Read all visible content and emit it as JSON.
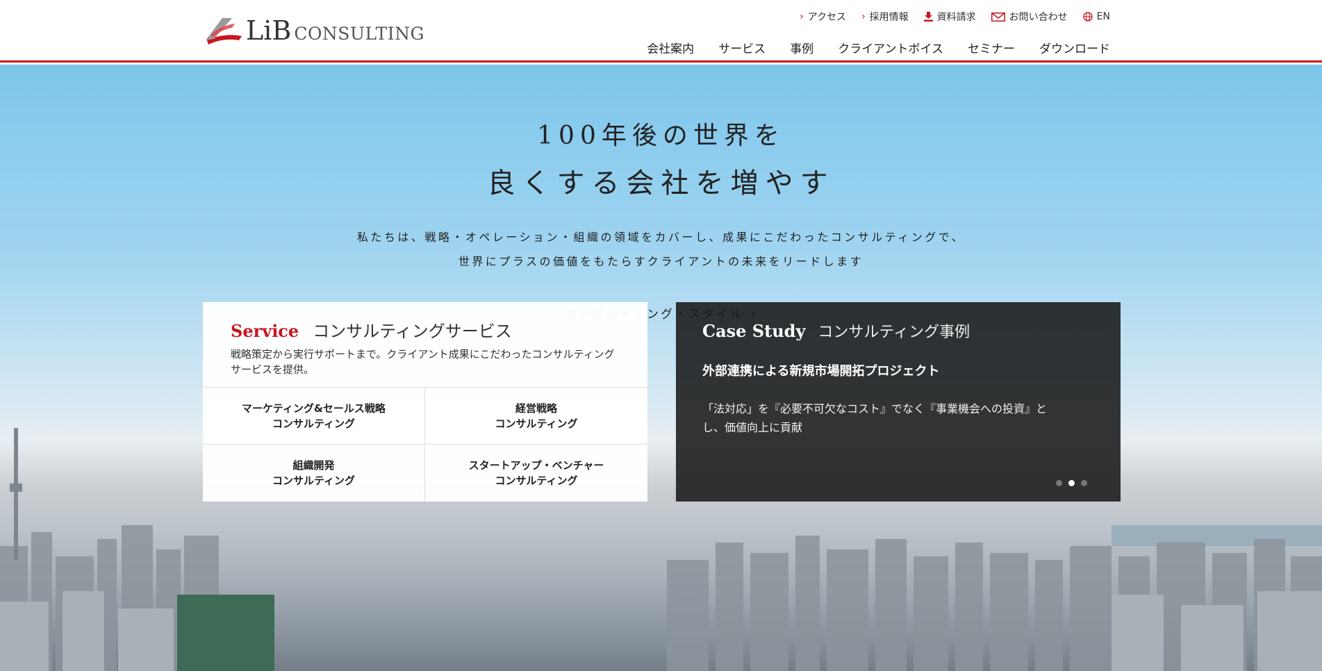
{
  "header": {
    "logo": {
      "brand": "LiB",
      "suffix": "CONSULTING"
    },
    "util_nav": [
      {
        "label": "アクセス",
        "icon": "chevron-right-icon"
      },
      {
        "label": "採用情報",
        "icon": "chevron-right-icon"
      },
      {
        "label": "資料請求",
        "icon": "download-icon"
      },
      {
        "label": "お問い合わせ",
        "icon": "mail-icon"
      },
      {
        "label": "EN",
        "icon": "globe-icon"
      }
    ],
    "main_nav": [
      "会社案内",
      "サービス",
      "事例",
      "クライアントボイス",
      "セミナー",
      "ダウンロード"
    ]
  },
  "hero": {
    "title_line1": "100年後の世界を",
    "title_line2": "良くする会社を増やす",
    "sub_line1": "私たちは、戦略・オペレーション・組織の領域をカバーし、成果にこだわったコンサルティングで、",
    "sub_line2": "世界にプラスの価値をもたらすクライアントの未来をリードします",
    "link_label": "コンサルティング・スタイル"
  },
  "service": {
    "title_en": "Service",
    "title_jp": "コンサルティングサービス",
    "description": "戦略策定から実行サポートまで。クライアント成果にこだわったコンサルティングサービスを提供。",
    "items": [
      {
        "line1": "マーケティング&セールス戦略",
        "line2": "コンサルティング"
      },
      {
        "line1": "経営戦略",
        "line2": "コンサルティング"
      },
      {
        "line1": "組織開発",
        "line2": "コンサルティング"
      },
      {
        "line1": "スタートアップ・ベンチャー",
        "line2": "コンサルティング"
      }
    ]
  },
  "case_study": {
    "title_en": "Case Study",
    "title_jp": "コンサルティング事例",
    "headline": "外部連携による新規市場開拓プロジェクト",
    "body_line1": "「法対応」を『必要不可欠なコスト』でなく『事業機会への投資』と",
    "body_line2": "し、価値向上に貢献",
    "slides_total": 3,
    "active_slide": 2
  },
  "colors": {
    "accent": "#c8161e",
    "sky": "#8fcdee"
  }
}
